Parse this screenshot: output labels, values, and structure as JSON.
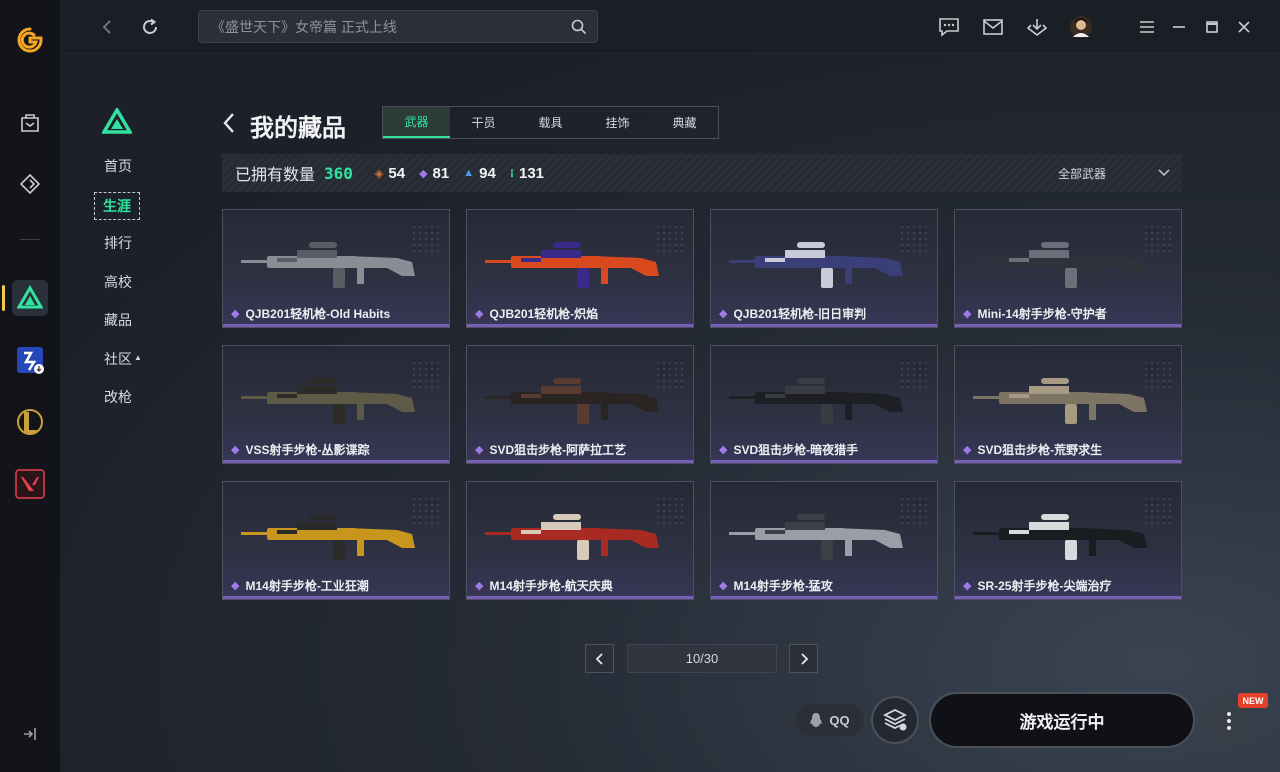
{
  "topbar": {
    "search_placeholder": "《盛世天下》女帝篇 正式上线"
  },
  "subnav": {
    "items": [
      {
        "label": "首页"
      },
      {
        "label": "生涯"
      },
      {
        "label": "排行"
      },
      {
        "label": "高校"
      },
      {
        "label": "藏品"
      },
      {
        "label": "社区"
      },
      {
        "label": "改枪"
      }
    ],
    "selected": "生涯"
  },
  "header": {
    "title": "我的藏品",
    "tabs": [
      {
        "label": "武器"
      },
      {
        "label": "干员"
      },
      {
        "label": "载具"
      },
      {
        "label": "挂饰"
      },
      {
        "label": "典藏"
      }
    ],
    "selected_tab": "武器"
  },
  "stats": {
    "owned_label": "已拥有数量",
    "owned_total": "360",
    "rarities": [
      {
        "icon": "orange-diamond-icon",
        "color": "#e0733a",
        "count": "54"
      },
      {
        "icon": "purple-diamond-icon",
        "color": "#9d7ae8",
        "count": "81"
      },
      {
        "icon": "blue-triangle-icon",
        "color": "#4a9bf0",
        "count": "94"
      },
      {
        "icon": "green-dots-icon",
        "color": "#31e3a1",
        "count": "131"
      }
    ],
    "filter_label": "全部武器"
  },
  "items": [
    {
      "name": "QJB201轻机枪-Old Habits",
      "color": "#8a8e94",
      "accent": "#5a5e64"
    },
    {
      "name": "QJB201轻机枪-炽焰",
      "color": "#d84a1e",
      "accent": "#3c2a8a"
    },
    {
      "name": "QJB201轻机枪-旧日审判",
      "color": "#3a3f7a",
      "accent": "#c9ccd8"
    },
    {
      "name": "Mini-14射手步枪-守护者",
      "color": "#2e323a",
      "accent": "#6a6f7a"
    },
    {
      "name": "VSS射手步枪-丛影谍踪",
      "color": "#5d5a45",
      "accent": "#2c2b25"
    },
    {
      "name": "SVD狙击步枪-阿萨拉工艺",
      "color": "#2a2523",
      "accent": "#5a3b32"
    },
    {
      "name": "SVD狙击步枪-暗夜猎手",
      "color": "#1e1f24",
      "accent": "#3a3c44"
    },
    {
      "name": "SVD狙击步枪-荒野求生",
      "color": "#7d7463",
      "accent": "#a69a82"
    },
    {
      "name": "M14射手步枪-工业狂潮",
      "color": "#c8951d",
      "accent": "#2a2a2a"
    },
    {
      "name": "M14射手步枪-航天庆典",
      "color": "#a82a22",
      "accent": "#d8c9b8"
    },
    {
      "name": "M14射手步枪-猛攻",
      "color": "#9a9ea6",
      "accent": "#3c3f46"
    },
    {
      "name": "SR-25射手步枪-尖端治疗",
      "color": "#1a1d20",
      "accent": "#d8dadc"
    }
  ],
  "pager": {
    "text": "10/30"
  },
  "bottom": {
    "qq_label": "QQ",
    "run_label": "游戏运行中",
    "new_badge": "NEW"
  },
  "colors": {
    "accent": "#31e3a1",
    "rare_purple": "#9d7ae8"
  }
}
